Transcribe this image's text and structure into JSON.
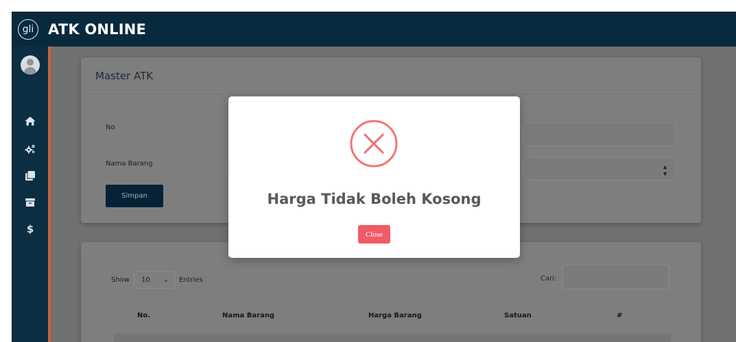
{
  "header": {
    "logo_text": "gli",
    "title": "ATK ONLINE"
  },
  "sidebar": {
    "items": [
      {
        "icon": "home-icon"
      },
      {
        "icon": "cogs-icon"
      },
      {
        "icon": "clone-icon"
      },
      {
        "icon": "archive-icon"
      },
      {
        "icon": "dollar-icon",
        "glyph": "$"
      }
    ]
  },
  "form_card": {
    "title": "Master ATK",
    "no_label": "No",
    "nama_barang_label": "Nama Barang",
    "save_label": "Simpan"
  },
  "table_card": {
    "show_label": "Show",
    "length_value": "10",
    "entries_label": "Entries",
    "search_label": "Cari:",
    "columns": [
      "No.",
      "Nama Barang",
      "Harga Barang",
      "Satuan",
      "#"
    ]
  },
  "modal": {
    "icon": "error-x-icon",
    "title": "Harga Tidak Boleh Kosong",
    "close_label": "Close"
  },
  "colors": {
    "topbar": "#082a3f",
    "sidebar": "#0b2e42",
    "sidebar_accent": "#c8623b",
    "save_button": "#062236",
    "error_red": "#f27474",
    "close_button": "#f05b66"
  }
}
